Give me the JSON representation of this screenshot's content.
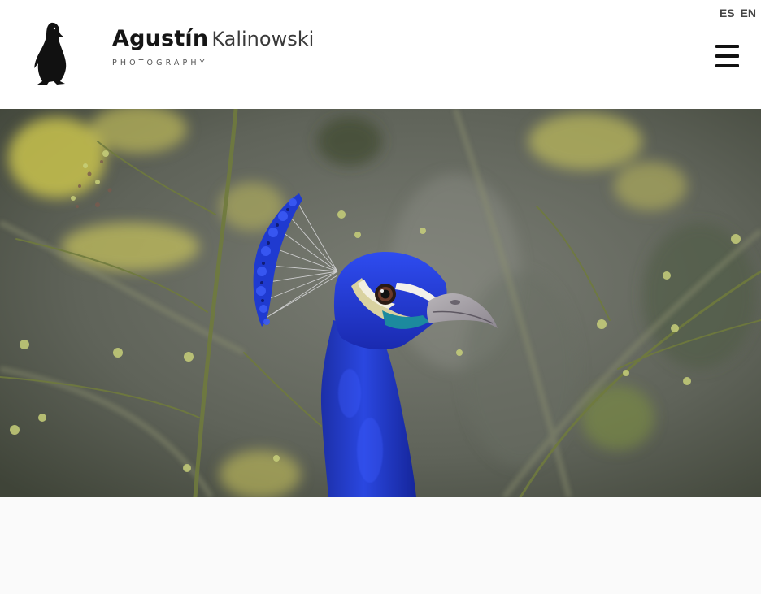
{
  "brand": {
    "first_name": "Agustín",
    "last_name": "Kalinowski",
    "tagline": "PHOTOGRAPHY",
    "logo_icon": "penguin-icon"
  },
  "language": {
    "options": [
      "ES",
      "EN"
    ]
  },
  "menu": {
    "icon": "hamburger-menu-icon"
  },
  "hero": {
    "subject": "peacock-photo"
  },
  "colors": {
    "header_bg": "#ffffff",
    "text_dark": "#151515",
    "page_bg": "#fafafa"
  }
}
